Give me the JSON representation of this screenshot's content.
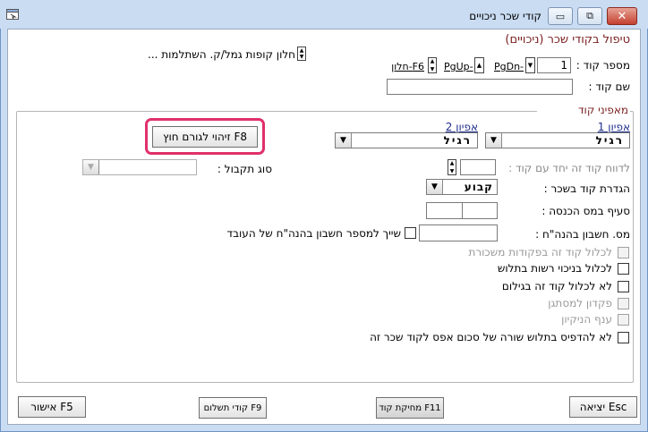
{
  "window": {
    "title": "קודי שכר ניכויים",
    "controls": {
      "minimize": "▭",
      "restore": "⧉",
      "close": "✕"
    }
  },
  "form": {
    "heading": "טיפול בקודי שכר (ניכויים)",
    "code_number_label": "מספר קוד :",
    "code_number_value": "1",
    "code_name_label": "שם קוד :",
    "code_name_value": "",
    "nav": {
      "pgdn": "PgDn-",
      "pgup": "PgUp-",
      "f6": "F6-חלון"
    },
    "pension_window_label": "חלון קופות גמל/ק. השתלמות ..."
  },
  "characteristics": {
    "group_label": "מאפיני קוד",
    "char1_label": "אפיון 1",
    "char1_value": "רגיל",
    "char2_label": "אפיון 2",
    "char2_value": "רגיל",
    "external_button": "זיהוי לגורם חוץ F8",
    "report_same_code_label": "לדווח קוד זה יחד עם קוד :",
    "report_same_code_value": "",
    "receipt_type_label": "סוג תקבול :",
    "receipt_type_value": "",
    "salary_def_label": "הגדרת קוד בשכר :",
    "salary_def_value": "קבוע",
    "tax_clause_label": "סעיף במס הכנסה :",
    "tax_clause_value_1": "",
    "tax_clause_value_2": "",
    "account_label": "מס. חשבון בהנה\"ח :",
    "account_value": "",
    "link_employee_label": "שייך למספר חשבון בהנה\"ח של העובד",
    "checkboxes": [
      {
        "label": "לכלול קוד זה בפקודות משכורת",
        "enabled": false,
        "checked": false
      },
      {
        "label": "לכלול בניכוי רשות בתלוש",
        "enabled": true,
        "checked": false
      },
      {
        "label": "לא לכלול קוד זה בגילום",
        "enabled": true,
        "checked": false
      },
      {
        "label": "פקדון למסתגן",
        "enabled": false,
        "checked": false
      },
      {
        "label": "ענף הניקיון",
        "enabled": false,
        "checked": false
      },
      {
        "label": "לא להדפיס בתלוש שורה של סכום אפס לקוד שכר זה",
        "enabled": true,
        "checked": false
      }
    ]
  },
  "footer": {
    "exit": "יציאה Esc",
    "delete": "מחיקת קוד F11",
    "payment_codes": "קודי תשלום F9",
    "approve": "אישור F5"
  },
  "colors": {
    "heading": "#7a1f1f",
    "group_label": "#7a1f1f",
    "char_label": "#1f2e8a",
    "highlight": "#e0306a"
  }
}
